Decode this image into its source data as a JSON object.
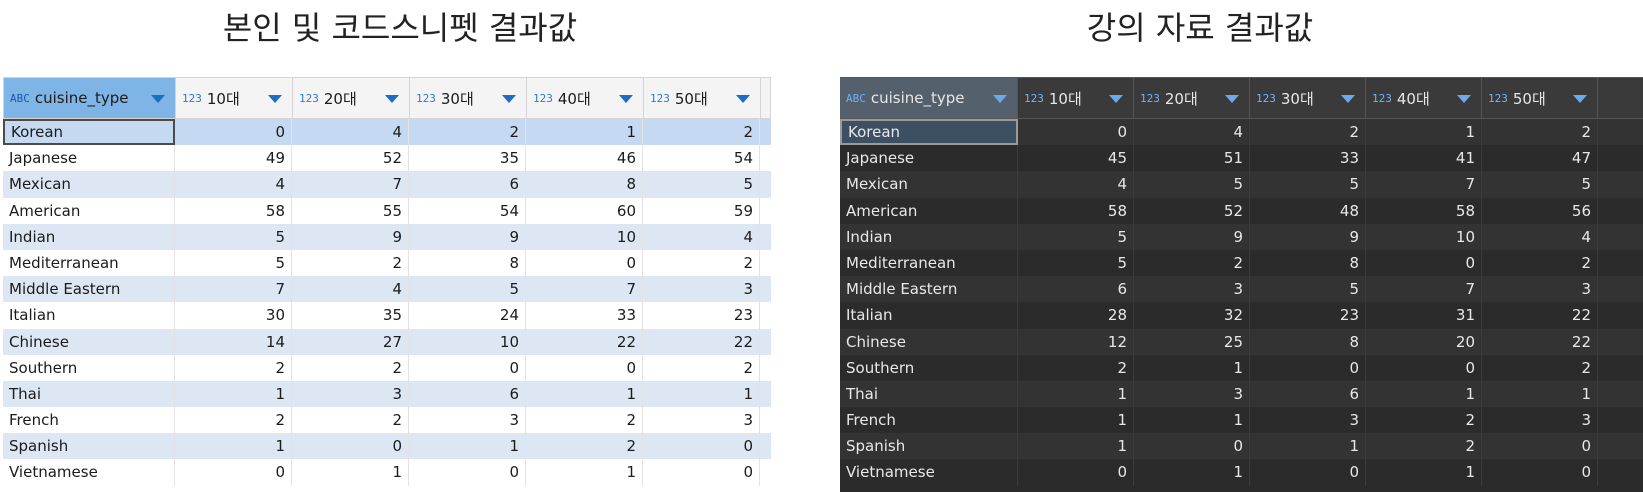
{
  "captions": {
    "left": "본인 및 코드스니펫 결과값",
    "right": "강의 자료 결과값"
  },
  "columns": [
    {
      "label": "cuisine_type",
      "type_badge": "ABC"
    },
    {
      "label": "10대",
      "type_badge": "123"
    },
    {
      "label": "20대",
      "type_badge": "123"
    },
    {
      "label": "30대",
      "type_badge": "123"
    },
    {
      "label": "40대",
      "type_badge": "123"
    },
    {
      "label": "50대",
      "type_badge": "123"
    }
  ],
  "left_rows": [
    [
      "Korean",
      "0",
      "4",
      "2",
      "1",
      "2"
    ],
    [
      "Japanese",
      "49",
      "52",
      "35",
      "46",
      "54"
    ],
    [
      "Mexican",
      "4",
      "7",
      "6",
      "8",
      "5"
    ],
    [
      "American",
      "58",
      "55",
      "54",
      "60",
      "59"
    ],
    [
      "Indian",
      "5",
      "9",
      "9",
      "10",
      "4"
    ],
    [
      "Mediterranean",
      "5",
      "2",
      "8",
      "0",
      "2"
    ],
    [
      "Middle Eastern",
      "7",
      "4",
      "5",
      "7",
      "3"
    ],
    [
      "Italian",
      "30",
      "35",
      "24",
      "33",
      "23"
    ],
    [
      "Chinese",
      "14",
      "27",
      "10",
      "22",
      "22"
    ],
    [
      "Southern",
      "2",
      "2",
      "0",
      "0",
      "2"
    ],
    [
      "Thai",
      "1",
      "3",
      "6",
      "1",
      "1"
    ],
    [
      "French",
      "2",
      "2",
      "3",
      "2",
      "3"
    ],
    [
      "Spanish",
      "1",
      "0",
      "1",
      "2",
      "0"
    ],
    [
      "Vietnamese",
      "0",
      "1",
      "0",
      "1",
      "0"
    ]
  ],
  "right_rows": [
    [
      "Korean",
      "0",
      "4",
      "2",
      "1",
      "2"
    ],
    [
      "Japanese",
      "45",
      "51",
      "33",
      "41",
      "47"
    ],
    [
      "Mexican",
      "4",
      "5",
      "5",
      "7",
      "5"
    ],
    [
      "American",
      "58",
      "52",
      "48",
      "58",
      "56"
    ],
    [
      "Indian",
      "5",
      "9",
      "9",
      "10",
      "4"
    ],
    [
      "Mediterranean",
      "5",
      "2",
      "8",
      "0",
      "2"
    ],
    [
      "Middle Eastern",
      "6",
      "3",
      "5",
      "7",
      "3"
    ],
    [
      "Italian",
      "28",
      "32",
      "23",
      "31",
      "22"
    ],
    [
      "Chinese",
      "12",
      "25",
      "8",
      "20",
      "22"
    ],
    [
      "Southern",
      "2",
      "1",
      "0",
      "0",
      "2"
    ],
    [
      "Thai",
      "1",
      "3",
      "6",
      "1",
      "1"
    ],
    [
      "French",
      "1",
      "1",
      "3",
      "2",
      "3"
    ],
    [
      "Spanish",
      "1",
      "0",
      "1",
      "2",
      "0"
    ],
    [
      "Vietnamese",
      "0",
      "1",
      "0",
      "1",
      "0"
    ]
  ],
  "selected_row": 0,
  "theme": {
    "left_selection": "#c5daf2",
    "left_alt_row": "#dde7f4",
    "right_background": "#2b2b2b",
    "type_badge_color": "#2f7bd1"
  }
}
